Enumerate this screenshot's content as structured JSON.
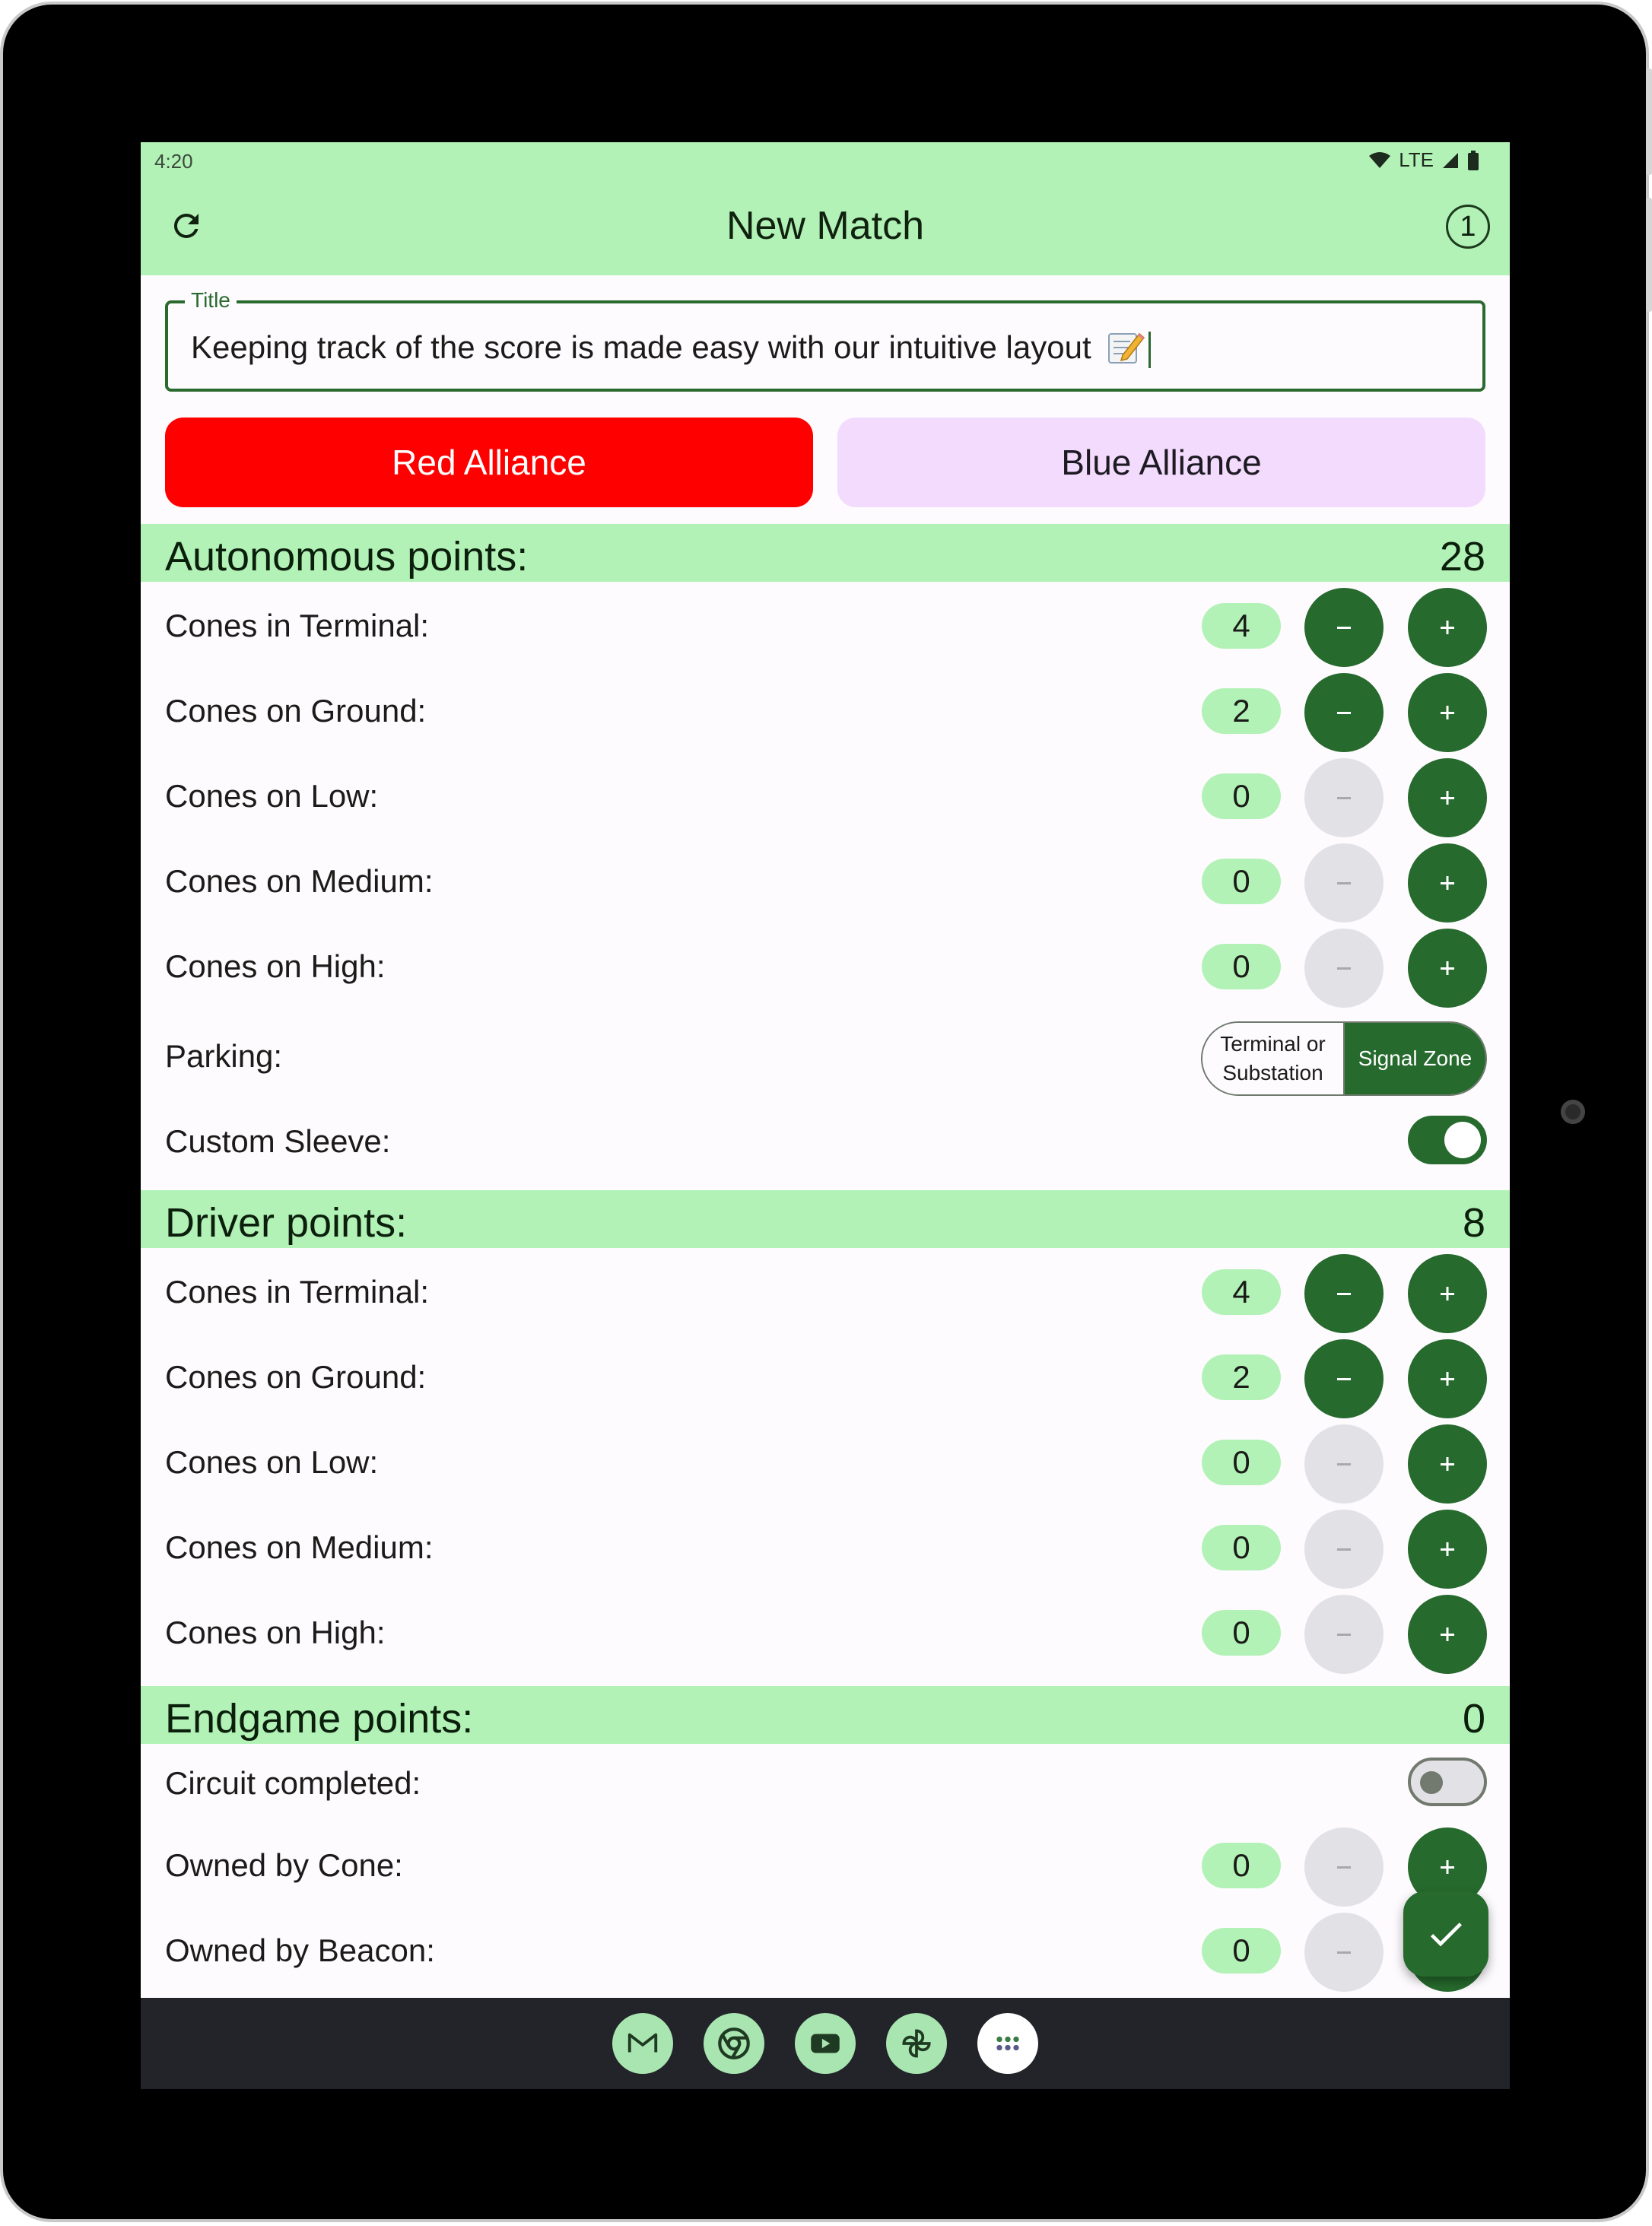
{
  "status": {
    "time": "4:20",
    "network": "LTE"
  },
  "appbar": {
    "title": "New Match",
    "match_count": "1",
    "refresh_icon": "refresh-icon"
  },
  "title_field": {
    "label": "Title",
    "value": "Keeping track of the score is made easy with our intuitive layout"
  },
  "alliances": {
    "red": "Red Alliance",
    "blue": "Blue Alliance",
    "selected": "red"
  },
  "colors": {
    "accent": "#266a2d",
    "header_bg": "#b2f2b6",
    "red": "#ff0000",
    "blue_bg": "#f3dbfd"
  },
  "autonomous": {
    "label": "Autonomous points:",
    "total": "28",
    "rows": [
      {
        "label": "Cones in Terminal:",
        "value": "4"
      },
      {
        "label": "Cones on Ground:",
        "value": "2"
      },
      {
        "label": "Cones on Low:",
        "value": "0"
      },
      {
        "label": "Cones on Medium:",
        "value": "0"
      },
      {
        "label": "Cones on High:",
        "value": "0"
      }
    ],
    "parking": {
      "label": "Parking:",
      "option_a": "Terminal or Substation",
      "option_b": "Signal Zone",
      "selected": "Signal Zone"
    },
    "custom_sleeve": {
      "label": "Custom Sleeve:",
      "on": true
    }
  },
  "driver": {
    "label": "Driver points:",
    "total": "8",
    "rows": [
      {
        "label": "Cones in Terminal:",
        "value": "4"
      },
      {
        "label": "Cones on Ground:",
        "value": "2"
      },
      {
        "label": "Cones on Low:",
        "value": "0"
      },
      {
        "label": "Cones on Medium:",
        "value": "0"
      },
      {
        "label": "Cones on High:",
        "value": "0"
      }
    ]
  },
  "endgame": {
    "label": "Endgame points:",
    "total": "0",
    "circuit": {
      "label": "Circuit completed:",
      "on": false
    },
    "rows": [
      {
        "label": "Owned by Cone:",
        "value": "0"
      },
      {
        "label": "Owned by Beacon:",
        "value": "0"
      }
    ]
  },
  "dock": [
    "gmail-icon",
    "chrome-icon",
    "youtube-icon",
    "photos-icon",
    "app-drawer-icon"
  ]
}
